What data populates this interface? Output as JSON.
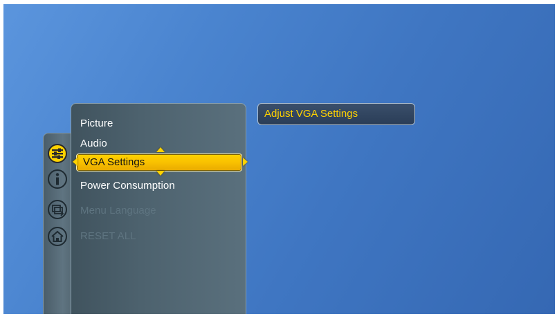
{
  "menu": {
    "items": [
      {
        "label": "Picture",
        "state": "normal"
      },
      {
        "label": "Audio",
        "state": "normal"
      },
      {
        "label": "VGA Settings",
        "state": "selected"
      },
      {
        "label": "Power Consumption",
        "state": "normal"
      },
      {
        "label": "Menu Language",
        "state": "disabled"
      },
      {
        "label": "RESET ALL",
        "state": "disabled"
      }
    ]
  },
  "submenu": {
    "label": "Adjust VGA Settings"
  },
  "tabs": [
    {
      "icon": "settings-sliders-icon",
      "active": true
    },
    {
      "icon": "info-icon",
      "active": false
    },
    {
      "icon": "source-input-icon",
      "active": false
    },
    {
      "icon": "home-icon",
      "active": false
    }
  ],
  "colors": {
    "accent": "#ffd200",
    "background": "#4a84cf",
    "panel": "#4d626e",
    "disabled_text": "#5e7480"
  }
}
